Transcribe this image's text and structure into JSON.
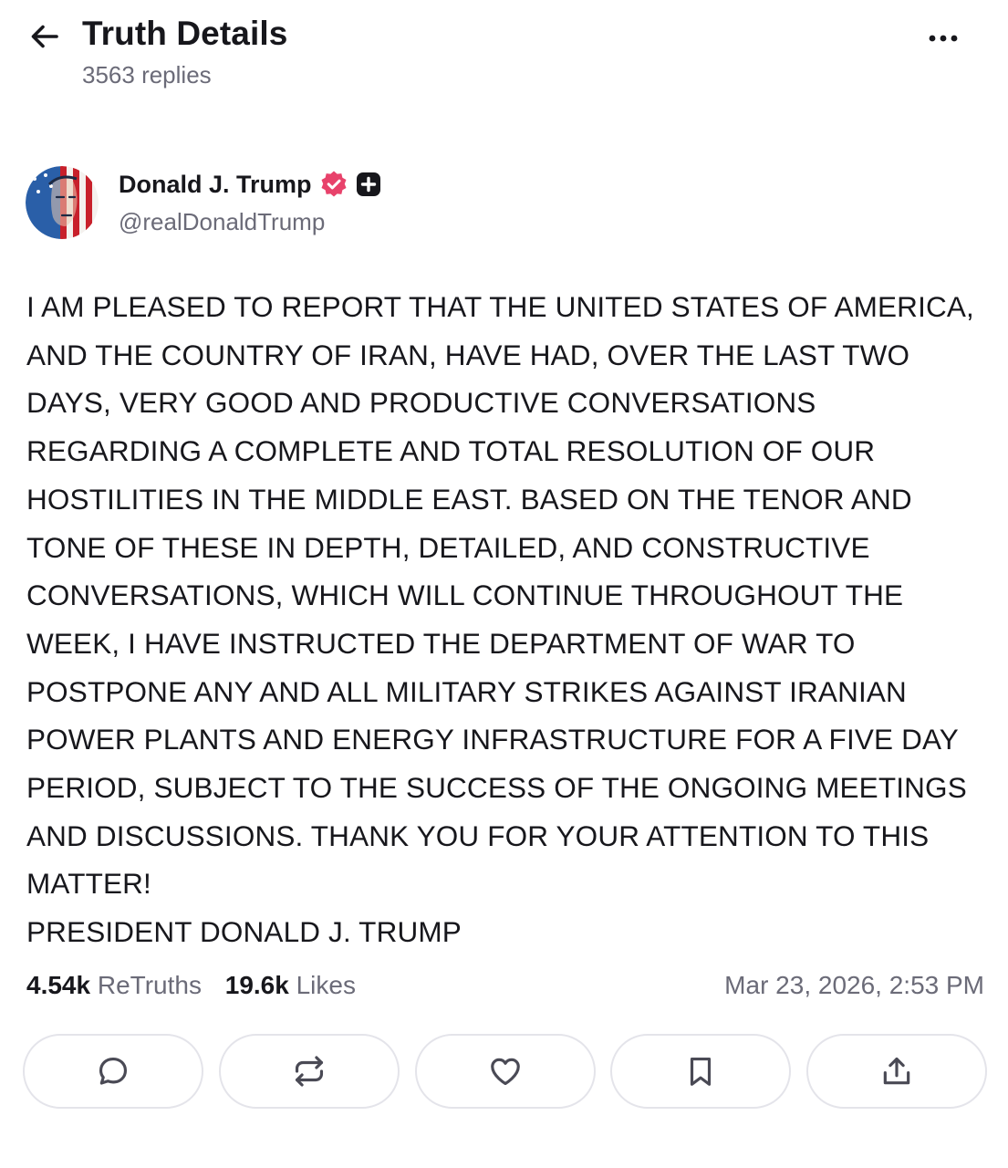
{
  "header": {
    "title": "Truth Details",
    "replies": "3563 replies"
  },
  "author": {
    "name": "Donald J. Trump",
    "handle": "@realDonaldTrump"
  },
  "post": {
    "text": "I AM PLEASED TO REPORT THAT THE UNITED STATES OF AMERICA, AND THE COUNTRY OF IRAN, HAVE HAD, OVER THE LAST TWO DAYS, VERY GOOD AND PRODUCTIVE CONVERSATIONS REGARDING A COMPLETE AND TOTAL RESOLUTION OF OUR HOSTILITIES IN THE MIDDLE EAST. BASED ON THE TENOR AND TONE OF THESE IN DEPTH, DETAILED, AND CONSTRUCTIVE CONVERSATIONS, WHICH WILL CONTINUE THROUGHOUT THE WEEK, I HAVE INSTRUCTED THE DEPARTMENT OF WAR TO POSTPONE ANY AND ALL MILITARY STRIKES AGAINST IRANIAN POWER PLANTS AND ENERGY INFRASTRUCTURE FOR A FIVE DAY PERIOD, SUBJECT TO THE SUCCESS OF THE ONGOING MEETINGS AND DISCUSSIONS. THANK YOU FOR YOUR ATTENTION TO THIS MATTER!\nPRESIDENT DONALD J. TRUMP"
  },
  "stats": {
    "retruths_count": "4.54k",
    "retruths_label": "ReTruths",
    "likes_count": "19.6k",
    "likes_label": "Likes",
    "timestamp": "Mar 23, 2026, 2:53 PM"
  },
  "actions": {
    "icons": [
      "reply-icon",
      "retruth-icon",
      "like-icon",
      "bookmark-icon",
      "share-icon"
    ]
  },
  "colors": {
    "text": "#17171c",
    "muted": "#6b6b78",
    "verified_badge": "#e8426b",
    "border": "#e4e4ea"
  }
}
